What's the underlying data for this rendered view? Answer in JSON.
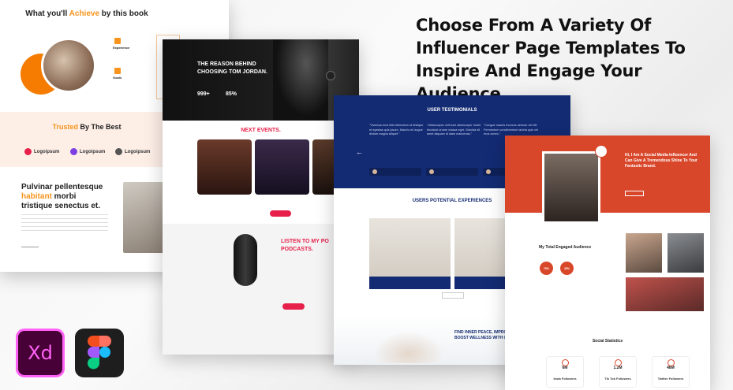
{
  "headline": "Choose From A Variety Of Influencer Page Templates To Inspire And Engage Your Audience",
  "page1": {
    "achieve_title_pre": "What you'll",
    "achieve_title_hl": "Achieve",
    "achieve_title_post": "by this book",
    "feature1": "Experience",
    "feature2": "Goals",
    "trusted_hl": "Trusted",
    "trusted_post": "By The Best",
    "logos": [
      "Logoipsum",
      "Logoipsum",
      "Logoipsum"
    ],
    "heading_line1": "Pulvinar pellentesque",
    "heading_hl": "habitant",
    "heading_post": "morbi",
    "heading_line3": "tristique senectus et."
  },
  "page2": {
    "hero_title_line1": "THE REASON BEHIND",
    "hero_title_line2": "CHOOSING TOM JORDAN.",
    "stat1_value": "999+",
    "stat2_value": "85%",
    "events_title": "NEXT EVENTS.",
    "podcast_title_line1": "LISTEN TO MY PO",
    "podcast_title_line2": "PODCASTS."
  },
  "page3": {
    "testimonials_title": "USER TESTIMONIALS",
    "testimonials": [
      "\"Vivamus eros felis bibendum ut tristique et egestas quis ipsum. Mauris vel augue dictum magna aliquet.\"",
      "\"Ullamcorper velit sed ullamcorper morbi tincidunt ornare massa eget. Gravida sit amet aliquam id diam maecenas.\"",
      "\"Congue mauris rhoncus aenean vel elit. Fermentum condimentum lacinia quis vel eros donec.\""
    ],
    "experiences_title": "USERS POTENTIAL EXPERIENCES",
    "bottom_title_line1": "FIND INNER PEACE, IMPROVE",
    "bottom_title_line2": "BOOST WELLNESS WITH OU"
  },
  "page4": {
    "hero_title": "Hi, I Am A Social Media Influencer And Can Give A Tremendous Shine To Your Fantastic Brand.",
    "audience_title": "My Total Engaged Audience",
    "ring1": "75%",
    "ring2": "25%",
    "social_title": "Social Statistics",
    "stats": [
      {
        "value": "6M",
        "label": "Insta Followers"
      },
      {
        "value": "1.2M",
        "label": "Tik Tok Followers"
      },
      {
        "value": "48M",
        "label": "Twitter Followers"
      }
    ]
  },
  "apps": {
    "xd_label": "Xd",
    "xd_color": "#470137",
    "xd_accent": "#ff61f6",
    "figma_bg": "#1e1e1e",
    "figma_colors": [
      "#f24e1e",
      "#ff7262",
      "#a259ff",
      "#1abcfe",
      "#0acf83"
    ]
  }
}
